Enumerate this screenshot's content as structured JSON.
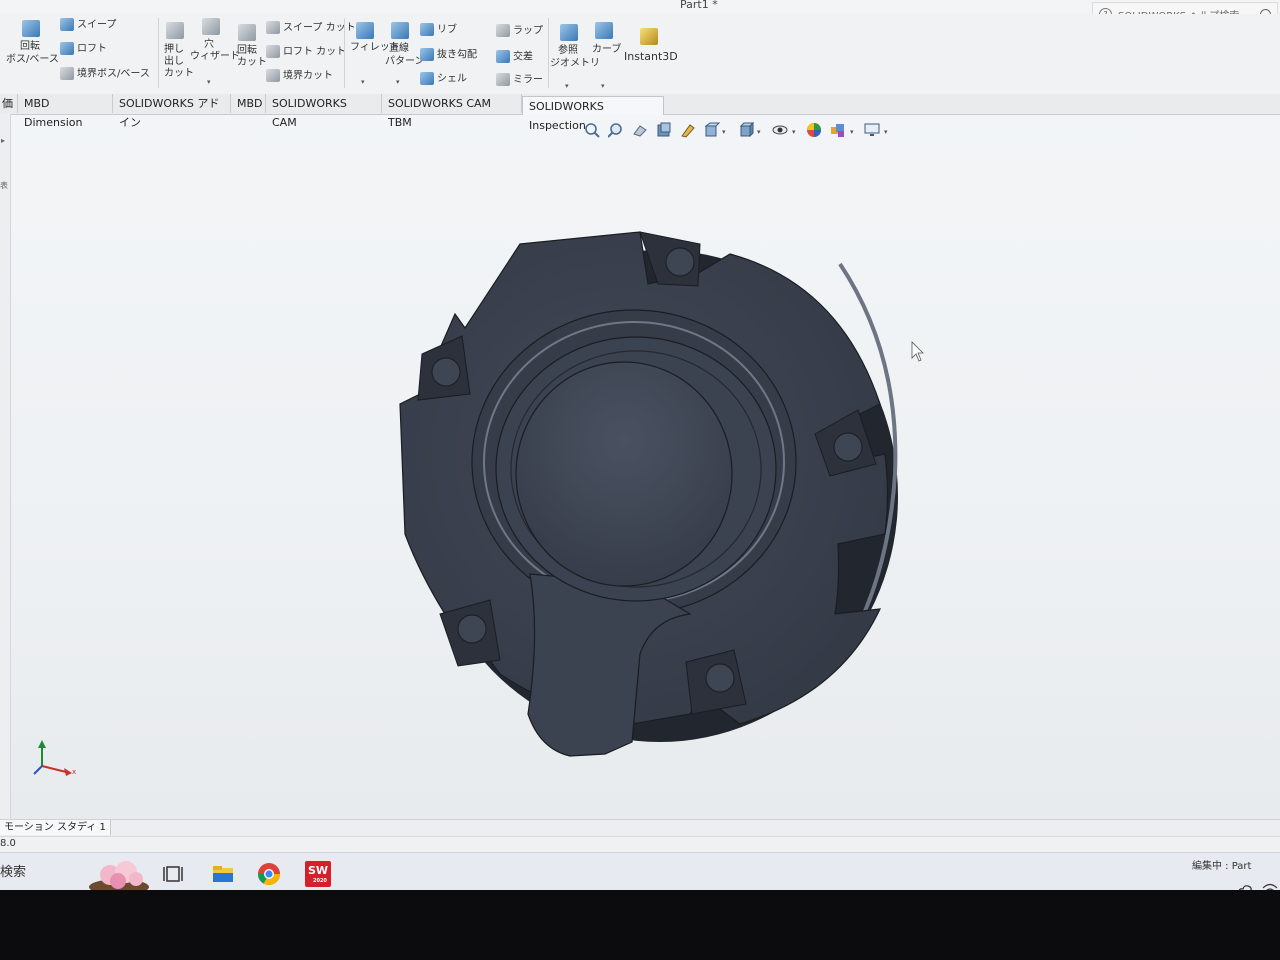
{
  "window": {
    "title": "Part1 *"
  },
  "help_search": {
    "placeholder": "SOLIDWORKS ヘルプ検索"
  },
  "ribbon": {
    "revolve_boss": [
      "回転",
      "ボス/ベース"
    ],
    "sweep": "スイープ",
    "loft": "ロフト",
    "boundary_boss": "境界ボス/ベース",
    "extruded_cut": [
      "押し",
      "出し",
      "カット"
    ],
    "hole_wizard": [
      "穴",
      "ウィザード"
    ],
    "revolved_cut": [
      "回転",
      "カット"
    ],
    "swept_cut": "スイープ カット",
    "lofted_cut": "ロフト カット",
    "boundary_cut": "境界カット",
    "fillet": "フィレット",
    "linear_pattern": [
      "直線",
      "パターン"
    ],
    "rib": "リブ",
    "draft": "抜き勾配",
    "shell": "シェル",
    "wrap": "ラップ",
    "intersect": "交差",
    "mirror": "ミラー",
    "reference_geometry": [
      "参照",
      "ジオメトリ"
    ],
    "curves": "カーブ",
    "instant3d": "Instant3D"
  },
  "tabs": [
    "価",
    "MBD Dimension",
    "SOLIDWORKS アドイン",
    "MBD",
    "SOLIDWORKS CAM",
    "SOLIDWORKS CAM TBM",
    "SOLIDWORKS Inspection"
  ],
  "active_tab_index": 6,
  "left_strip": {
    "text_1": "▸",
    "text_2": "表"
  },
  "triad": {
    "x_label": "x"
  },
  "motion_tab": "モーション スタディ 1",
  "statusbar": {
    "version": "8.0",
    "editing": "編集中 : Part"
  },
  "taskbar": {
    "search": "検索",
    "solidworks_badge": "SW",
    "solidworks_year": "2020"
  },
  "colors": {
    "part_body": "#3a4150",
    "viewport_top": "#f4f6f8",
    "accent": "#3a78b5"
  },
  "icons": [
    "zoom-to-fit-icon",
    "zoom-area-icon",
    "previous-view-icon",
    "section-view-icon",
    "dynamic-annotation-icon",
    "view-orientation-icon",
    "display-style-icon",
    "hide-show-icon",
    "edit-appearance-icon",
    "apply-scene-icon",
    "view-settings-icon"
  ]
}
